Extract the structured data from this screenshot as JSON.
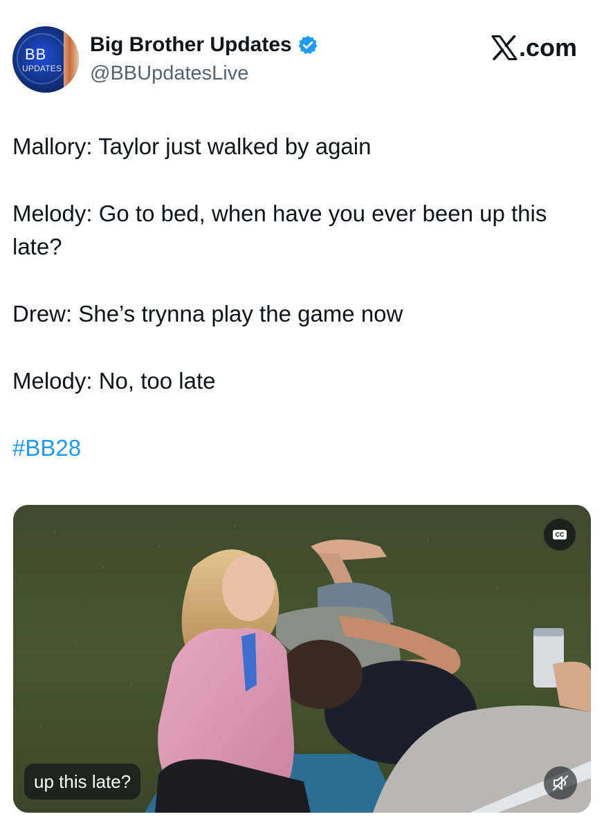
{
  "author": {
    "display_name": "Big Brother Updates",
    "handle": "@BBUpdatesLive",
    "verified": true,
    "avatar_text": "BB",
    "avatar_subtext": "UPDATES"
  },
  "brand": {
    "logo_icon": "x-logo-icon",
    "label": ".com"
  },
  "tweet": {
    "paragraphs": [
      "Mallory: Taylor just walked by again",
      "Melody: Go to bed, when have you ever been up this late?",
      "Drew: She’s trynna play the game now",
      "Melody: No, too late"
    ],
    "hashtag": "#BB28"
  },
  "media": {
    "type": "video",
    "caption": "up this late?",
    "cc_label": "CC",
    "cc_icon": "closed-captions-icon",
    "mute_icon": "speaker-muted-icon"
  },
  "colors": {
    "text": "#0f1419",
    "secondary": "#536471",
    "link": "#1d9bf0",
    "verified": "#1d9bf0"
  }
}
